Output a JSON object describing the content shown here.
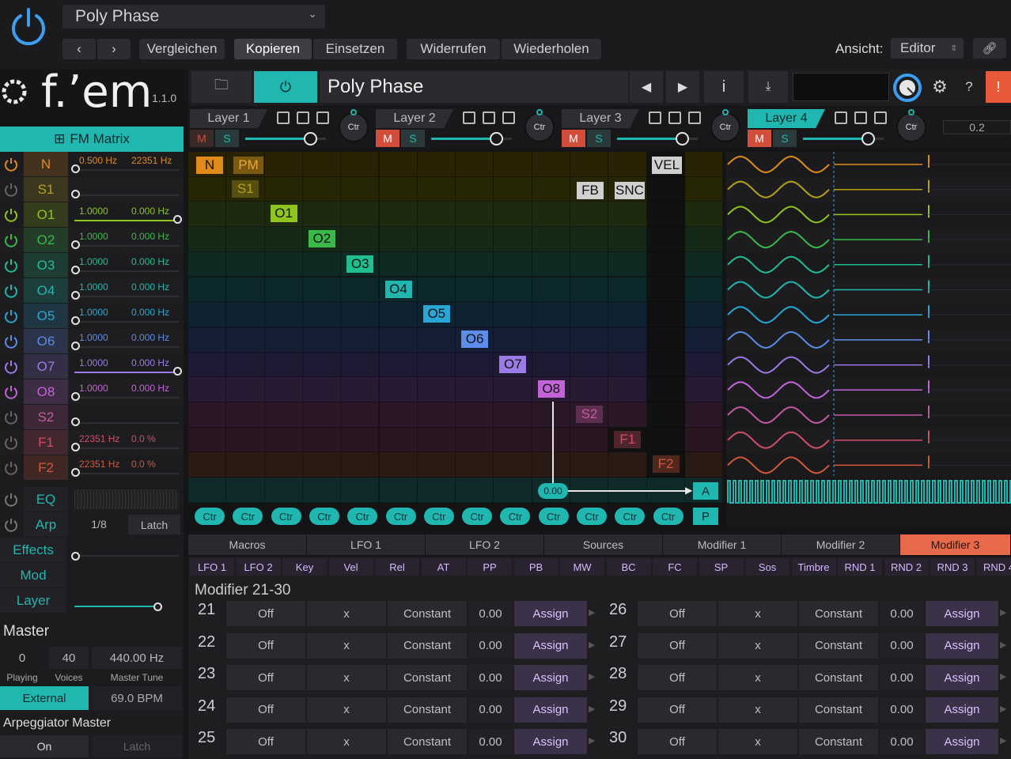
{
  "host": {
    "preset_name": "Poly Phase",
    "buttons": [
      "Vergleichen",
      "Kopieren",
      "Einsetzen",
      "Widerrufen",
      "Wiederholen"
    ],
    "view_label": "Ansicht:",
    "view_value": "Editor"
  },
  "plugin": {
    "logo": "f.’em",
    "version": "1.1.0",
    "preset_name": "Poly Phase",
    "value_display": "0.2"
  },
  "layers": [
    {
      "name": "Layer 1"
    },
    {
      "name": "Layer 2"
    },
    {
      "name": "Layer 3"
    },
    {
      "name": "Layer 4"
    }
  ],
  "layer_ms": {
    "m": "M",
    "s": "S",
    "knob": "Ctr"
  },
  "sidebar": {
    "title": "FM Matrix",
    "rows": [
      {
        "label": "N",
        "v1": "0.500 Hz",
        "v2": "22351 Hz",
        "color": "#e08a1a"
      },
      {
        "label": "S1",
        "v1": "",
        "v2": "",
        "color": "#b6a11a"
      },
      {
        "label": "O1",
        "v1": "1.0000",
        "v2": "0.000 Hz",
        "color": "#8fc51d"
      },
      {
        "label": "O2",
        "v1": "1.0000",
        "v2": "0.000 Hz",
        "color": "#3ab84a"
      },
      {
        "label": "O3",
        "v1": "1.0000",
        "v2": "0.000 Hz",
        "color": "#1fbf8e"
      },
      {
        "label": "O4",
        "v1": "1.0000",
        "v2": "0.000 Hz",
        "color": "#1fb7b0"
      },
      {
        "label": "O5",
        "v1": "1.0000",
        "v2": "0.000 Hz",
        "color": "#2aa6d4"
      },
      {
        "label": "O6",
        "v1": "1.0000",
        "v2": "0.000 Hz",
        "color": "#5d8de8"
      },
      {
        "label": "O7",
        "v1": "1.0000",
        "v2": "0.000 Hz",
        "color": "#9b7be6"
      },
      {
        "label": "O8",
        "v1": "1.0000",
        "v2": "0.000 Hz",
        "color": "#c264d8"
      },
      {
        "label": "S2",
        "v1": "",
        "v2": "",
        "color": "#c45aa0"
      },
      {
        "label": "F1",
        "v1": "22351 Hz",
        "v2": "0.0 %",
        "color": "#d24d66"
      },
      {
        "label": "F2",
        "v1": "22351 Hz",
        "v2": "0.0 %",
        "color": "#d2583a"
      }
    ],
    "eq": "EQ",
    "arp": "Arp",
    "arp_rate": "1/8",
    "arp_latch": "Latch",
    "effects": "Effects",
    "mod": "Mod",
    "layer": "Layer",
    "master": "Master",
    "playing_val": "0",
    "playing_lbl": "Playing",
    "voices_val": "40",
    "voices_lbl": "Voices",
    "tune_val": "440.00 Hz",
    "tune_lbl": "Master Tune",
    "external": "External",
    "bpm": "69.0 BPM",
    "arp_master": "Arpeggiator Master",
    "on": "On",
    "latch": "Latch"
  },
  "matrix": {
    "top_labels": [
      "N",
      "PM",
      "VEL"
    ],
    "diag": [
      "S1",
      "O1",
      "O2",
      "O3",
      "O4",
      "O5",
      "O6",
      "O7",
      "O8",
      "S2",
      "F1",
      "F2"
    ],
    "fb": "FB",
    "snc": "SNC",
    "out_val": "0.00",
    "a": "A",
    "p": "P",
    "ctr": "Ctr"
  },
  "tabs": [
    "Macros",
    "LFO 1",
    "LFO 2",
    "Sources",
    "Modifier 1",
    "Modifier 2",
    "Modifier 3"
  ],
  "sources": [
    "LFO 1",
    "LFO 2",
    "Key",
    "Vel",
    "Rel",
    "AT",
    "PP",
    "PB",
    "MW",
    "BC",
    "FC",
    "SP",
    "Sos",
    "Timbre",
    "RND 1",
    "RND 2",
    "RND 3",
    "RND 4"
  ],
  "modifier": {
    "title": "Modifier 21-30",
    "left": [
      {
        "n": "21",
        "a": "Off",
        "op": "x",
        "b": "Constant",
        "v": "0.00",
        "assign": "Assign"
      },
      {
        "n": "22",
        "a": "Off",
        "op": "x",
        "b": "Constant",
        "v": "0.00",
        "assign": "Assign"
      },
      {
        "n": "23",
        "a": "Off",
        "op": "x",
        "b": "Constant",
        "v": "0.00",
        "assign": "Assign"
      },
      {
        "n": "24",
        "a": "Off",
        "op": "x",
        "b": "Constant",
        "v": "0.00",
        "assign": "Assign"
      },
      {
        "n": "25",
        "a": "Off",
        "op": "x",
        "b": "Constant",
        "v": "0.00",
        "assign": "Assign"
      }
    ],
    "right": [
      {
        "n": "26",
        "a": "Off",
        "op": "x",
        "b": "Constant",
        "v": "0.00",
        "assign": "Assign"
      },
      {
        "n": "27",
        "a": "Off",
        "op": "x",
        "b": "Constant",
        "v": "0.00",
        "assign": "Assign"
      },
      {
        "n": "28",
        "a": "Off",
        "op": "x",
        "b": "Constant",
        "v": "0.00",
        "assign": "Assign"
      },
      {
        "n": "29",
        "a": "Off",
        "op": "x",
        "b": "Constant",
        "v": "0.00",
        "assign": "Assign"
      },
      {
        "n": "30",
        "a": "Off",
        "op": "x",
        "b": "Constant",
        "v": "0.00",
        "assign": "Assign"
      }
    ]
  },
  "colors": {
    "accent": "#1fb7b0",
    "active_tab": "#e86a4a",
    "warn": "#e8593a"
  }
}
